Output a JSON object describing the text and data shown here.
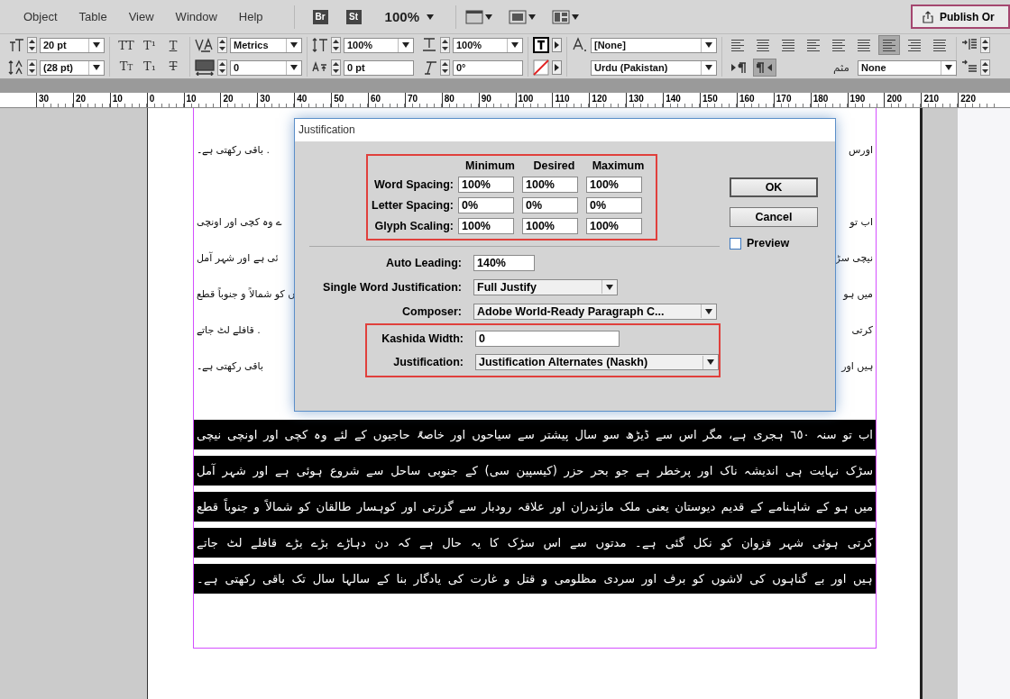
{
  "menu": {
    "items": [
      "Object",
      "Table",
      "View",
      "Window",
      "Help"
    ],
    "apps": [
      "Br",
      "St"
    ],
    "zoom": "100%",
    "publish": "Publish Or"
  },
  "control_panel": {
    "font_size": "20 pt",
    "leading": "(28 pt)",
    "styles": [
      {
        "kind": "caps",
        "label": "TT"
      },
      {
        "kind": "super",
        "label": "T¹"
      },
      {
        "kind": "underline",
        "label": "T"
      },
      {
        "kind": "smallcaps",
        "label": "Tт"
      },
      {
        "kind": "sub",
        "label": "T₁"
      },
      {
        "kind": "strike",
        "label": "T"
      }
    ],
    "kerning": "Metrics",
    "tracking": "0",
    "vertical_scale": "100%",
    "baseline_shift": "0 pt",
    "horizontal_scale": "100%",
    "skew": "0°",
    "character_style": "[None]",
    "language": "Urdu (Pakistan)",
    "alignments": [
      {
        "selected": false
      },
      {
        "selected": false
      },
      {
        "selected": false
      },
      {
        "selected": false
      },
      {
        "selected": false
      },
      {
        "selected": false
      },
      {
        "selected": true
      },
      {
        "selected": false
      },
      {
        "selected": false
      }
    ],
    "directions": [
      {
        "selected": false
      },
      {
        "selected": true
      }
    ],
    "kashida_label": "مثم",
    "kashida": "None"
  },
  "ruler": [
    "30",
    "20",
    "10",
    "0",
    "10",
    "20",
    "30",
    "40",
    "50",
    "60",
    "70",
    "80",
    "90",
    "100",
    "110",
    "120",
    "130",
    "140",
    "150",
    "160",
    "170",
    "180",
    "190",
    "200",
    "210",
    "220"
  ],
  "document": {
    "upper_lines": [
      {
        "left": ". باقی رکھتی ہے۔",
        "right": "اورس"
      },
      {
        "left": "ے وہ کچی اور اونچی",
        "right": "اب تو"
      },
      {
        "left": "ئی ہے اور شہر آمل",
        "right": "نیچی سڑ"
      },
      {
        "left": "ں کو شمالاً و جنوباً قطع",
        "right": "میں ہو"
      },
      {
        "left": ". قافلے لٹ جاتے",
        "right": "کرتی"
      },
      {
        "left": "باقی رکھتی ہے۔",
        "right": "ہیں اور"
      }
    ],
    "highlighted_lines": [
      "اب تو سنہ ٦٥٠ ہجری ہے، مگر اس سے ڈیڑھ سو سال پیشتر سے سیاحوں اور خاصۃً حاجیوں کے لئے وہ کچی اور اونچی نیچی",
      "سڑک نہایت ہی اندیشہ ناک اور پرخطر ہے جو بحر حزر (کیسپین سی) کے جنوبی ساحل سے شروع ہوئی ہے اور شہر آمل",
      "میں ہو کے شاہنامے کے قدیم دیوستان یعنی ملک ماژندران اور علاقہ رودبار سے گزرتی اور کوہسار طالقان کو شمالاً و جنوباً قطع",
      "کرتی ہوئی شہر قزوان کو نکل گئی ہے۔ مدتوں سے اس سڑک کا یہ حال ہے کہ دن دہاڑے بڑے بڑے قافلے لٹ جاتے",
      "ہیں اور بے گناہوں کی لاشوں کو برف اور سردی مظلومی و قتل و غارت کی یادگار بنا کے سالہا سال تک باقی رکھتی ہے۔"
    ]
  },
  "dialog": {
    "title": "Justification",
    "spacing": {
      "highlighted": true,
      "columns": [
        "Minimum",
        "Desired",
        "Maximum"
      ],
      "rows": [
        {
          "label": "Word Spacing:",
          "values": [
            "100%",
            "100%",
            "100%"
          ]
        },
        {
          "label": "Letter Spacing:",
          "values": [
            "0%",
            "0%",
            "0%"
          ]
        },
        {
          "label": "Glyph Scaling:",
          "values": [
            "100%",
            "100%",
            "100%"
          ]
        }
      ]
    },
    "auto_leading": {
      "label": "Auto Leading:",
      "value": "140%"
    },
    "single_word": {
      "label": "Single Word Justification:",
      "value": "Full Justify"
    },
    "composer": {
      "label": "Composer:",
      "value": "Adobe World-Ready Paragraph C..."
    },
    "arabic": {
      "highlighted": true,
      "kashida_width": {
        "label": "Kashida Width:",
        "value": "0"
      },
      "justification": {
        "label": "Justification:",
        "value": "Justification Alternates (Naskh)"
      }
    },
    "buttons": [
      "OK",
      "Cancel"
    ],
    "preview": {
      "label": "Preview",
      "checked": false
    }
  }
}
